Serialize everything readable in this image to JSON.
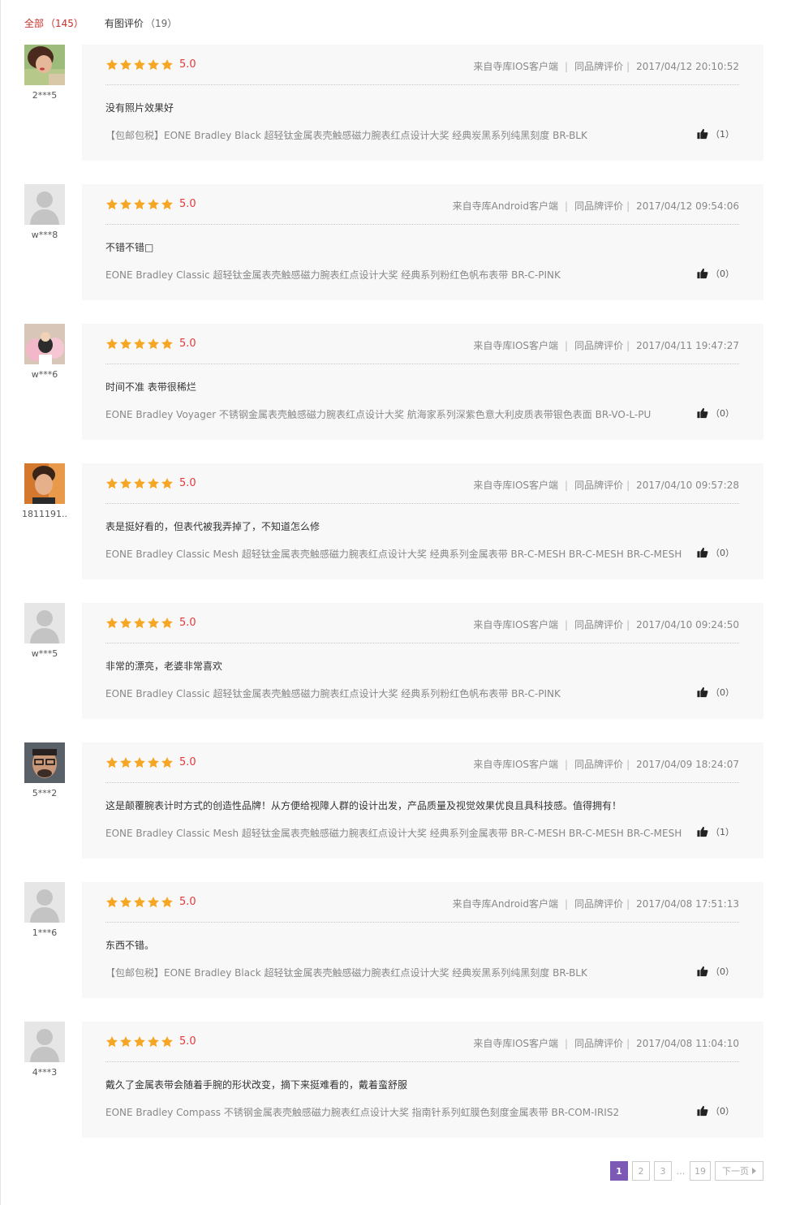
{
  "tabs": [
    {
      "label": "全部",
      "count": "（145）",
      "active": true
    },
    {
      "label": "有图评价",
      "count": "（19）",
      "active": false
    }
  ],
  "colors": {
    "accent": "#c9302c",
    "star": "#f5a623",
    "score": "#e4393c",
    "page_active": "#7b59b5"
  },
  "reviews": [
    {
      "username": "2***5",
      "avatar": "photo-woman-green",
      "score": "5.0",
      "source": "来自寺库IOS客户端",
      "brand_label": "同品牌评价",
      "datetime": "2017/04/12 20:10:52",
      "comment": "没有照片效果好",
      "product": "【包邮包税】EONE Bradley Black 超轻钛金属表壳触感磁力腕表红点设计大奖 经典炭黑系列纯黑刻度 BR-BLK",
      "likes": "（1）"
    },
    {
      "username": "w***8",
      "avatar": "default-user-icon",
      "score": "5.0",
      "source": "来自寺库Android客户端",
      "brand_label": "同品牌评价",
      "datetime": "2017/04/12 09:54:06",
      "comment": "不错不错□",
      "product": "EONE Bradley Classic 超轻钛金属表壳触感磁力腕表红点设计大奖 经典系列粉红色帆布表带 BR-C-PINK",
      "likes": "（0）"
    },
    {
      "username": "w***6",
      "avatar": "photo-toys",
      "score": "5.0",
      "source": "来自寺库IOS客户端",
      "brand_label": "同品牌评价",
      "datetime": "2017/04/11 19:47:27",
      "comment": "时间不准 表带很稀烂",
      "product": "EONE Bradley Voyager 不锈钢金属表壳触感磁力腕表红点设计大奖 航海家系列深紫色意大利皮质表带银色表面 BR-VO-L-PU",
      "likes": "（0）"
    },
    {
      "username": "1811191...",
      "avatar": "photo-man-orange",
      "score": "5.0",
      "source": "来自寺库IOS客户端",
      "brand_label": "同品牌评价",
      "datetime": "2017/04/10 09:57:28",
      "comment": "表是挺好看的，但表代被我弄掉了，不知道怎么修",
      "product": "EONE Bradley Classic Mesh 超轻钛金属表壳触感磁力腕表红点设计大奖 经典系列金属表带 BR-C-MESH BR-C-MESH BR-C-MESH",
      "likes": "（0）"
    },
    {
      "username": "w***5",
      "avatar": "default-user-icon",
      "score": "5.0",
      "source": "来自寺库IOS客户端",
      "brand_label": "同品牌评价",
      "datetime": "2017/04/10 09:24:50",
      "comment": "非常的漂亮，老婆非常喜欢",
      "product": "EONE Bradley Classic 超轻钛金属表壳触感磁力腕表红点设计大奖 经典系列粉红色帆布表带 BR-C-PINK",
      "likes": "（0）"
    },
    {
      "username": "5***2",
      "avatar": "photo-man-glasses",
      "score": "5.0",
      "source": "来自寺库IOS客户端",
      "brand_label": "同品牌评价",
      "datetime": "2017/04/09 18:24:07",
      "comment": "这是颠覆腕表计时方式的创造性品牌！从方便给视障人群的设计出发，产品质量及视觉效果优良且具科技感。值得拥有！",
      "product": "EONE Bradley Classic Mesh 超轻钛金属表壳触感磁力腕表红点设计大奖 经典系列金属表带 BR-C-MESH BR-C-MESH BR-C-MESH",
      "likes": "（1）"
    },
    {
      "username": "1***6",
      "avatar": "default-user-icon",
      "score": "5.0",
      "source": "来自寺库Android客户端",
      "brand_label": "同品牌评价",
      "datetime": "2017/04/08 17:51:13",
      "comment": "东西不错。",
      "product": "【包邮包税】EONE Bradley Black 超轻钛金属表壳触感磁力腕表红点设计大奖 经典炭黑系列纯黑刻度 BR-BLK",
      "likes": "（0）"
    },
    {
      "username": "4***3",
      "avatar": "default-user-icon",
      "score": "5.0",
      "source": "来自寺库IOS客户端",
      "brand_label": "同品牌评价",
      "datetime": "2017/04/08 11:04:10",
      "comment": "戴久了金属表带会随着手腕的形状改变，摘下来挺难看的，戴着蛮舒服",
      "product": "EONE Bradley Compass 不锈钢金属表壳触感磁力腕表红点设计大奖 指南针系列虹膜色刻度金属表带 BR-COM-IRIS2",
      "likes": "（0）"
    }
  ],
  "pagination": {
    "pages": [
      "1",
      "2",
      "3"
    ],
    "ellipsis": "...",
    "last": "19",
    "next": "下一页"
  }
}
